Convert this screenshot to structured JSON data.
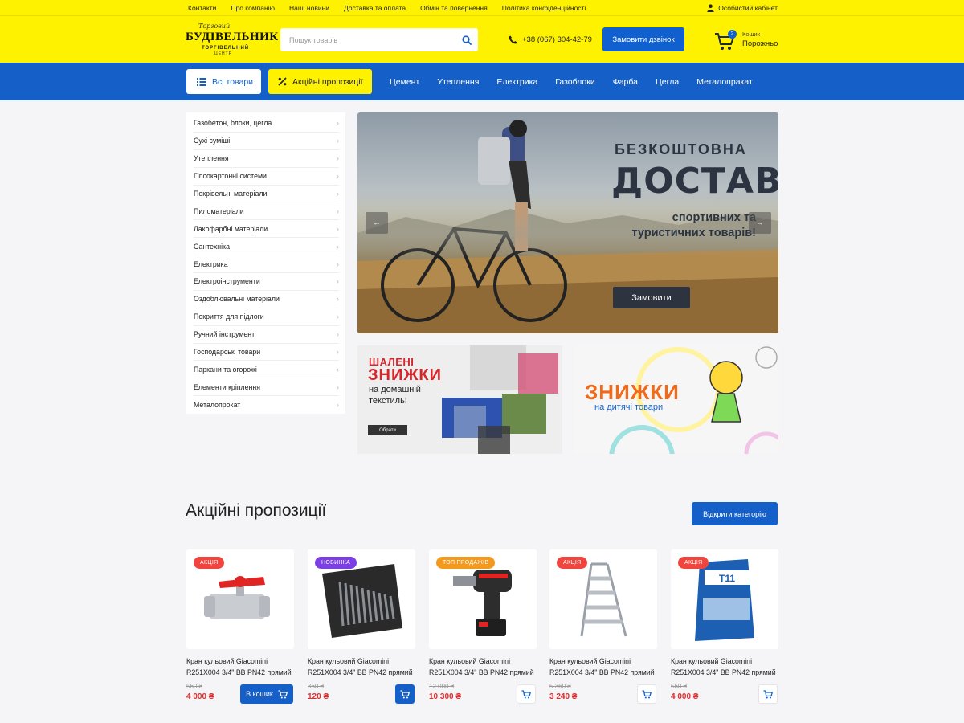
{
  "topbar": {
    "links": [
      "Контакти",
      "Про компанію",
      "Наші новини",
      "Доставка та оплата",
      "Обмін та повернення",
      "Політика конфіденційності"
    ],
    "cabinet": "Особистий кабінет"
  },
  "header": {
    "logo": {
      "script": "Торговий",
      "main": "БУДІВЕЛЬНИК",
      "sub": "ТОРГІВЕЛЬНИЙ",
      "sub2": "ЦЕНТР"
    },
    "search_placeholder": "Пошук товарів",
    "phone": "+38 (067) 304-42-79",
    "call_button": "Замовити дзвінок",
    "cart": {
      "count": "2",
      "label": "Кошик",
      "value": "Порожньо"
    }
  },
  "nav": {
    "all_products": "Всі товари",
    "promo": "Акційні пропозиції",
    "links": [
      "Цемент",
      "Утеплення",
      "Електрика",
      "Газоблоки",
      "Фарба",
      "Цегла",
      "Металопракат"
    ]
  },
  "sidebar": {
    "categories": [
      "Газобетон,  блоки, цегла",
      "Сухі суміші",
      "Утеплення",
      "Гіпсокартонні системи",
      "Покрівельні матеріали",
      "Пиломатеріали",
      "Лакофарбні матеріали",
      "Сантехніка",
      "Електрика",
      "Електроінструменти",
      "Оздоблювальні матеріали",
      "Покриття для підлоги",
      "Ручний інструмент",
      "Господарські товари",
      "Паркани та огорожі",
      "Елементи кріплення",
      "Металопрокат"
    ]
  },
  "hero": {
    "line1": "БЕЗКОШТОВНА",
    "line2": "ДОСТАВКА",
    "line3": "спортивних та туристичних товарів!",
    "button": "Замовити",
    "prev": "←",
    "next": "→"
  },
  "banners": {
    "textile": {
      "line1": "ШАЛЕНІ",
      "line2": "ЗНИЖКИ",
      "line3": "на домашній текстиль!",
      "button": "Обрати"
    },
    "kids": {
      "line1": "ЗНИЖКИ",
      "line2": "на дитячі товари"
    }
  },
  "promo_section": {
    "title": "Акційні пропозиції",
    "open_category": "Відкрити категорію",
    "products": [
      {
        "tag": "АКЦІЯ",
        "tag_color": "#f0453f",
        "name": "Кран кульовий Giacomini R251X004 3/4\" ВВ PN42 прямий",
        "old_price": "560 ₴",
        "price": "4 000 ₴",
        "buy_label": "В кошик",
        "buy_style": "full",
        "image": "valve"
      },
      {
        "tag": "НОВИНКА",
        "tag_color": "#7b3fe4",
        "name": "Кран кульовий Giacomini R251X004 3/4\" ВВ PN42 прямий",
        "old_price": "360 ₴",
        "price": "120 ₴",
        "buy_label": "",
        "buy_style": "solid",
        "image": "drills"
      },
      {
        "tag": "ТОП ПРОДАЖІВ",
        "tag_color": "#f39a1e",
        "name": "Кран кульовий Giacomini R251X004 3/4\" ВВ PN42 прямий",
        "old_price": "12 000 ₴",
        "price": "10 300 ₴",
        "buy_label": "",
        "buy_style": "ghost",
        "image": "drill"
      },
      {
        "tag": "АКЦІЯ",
        "tag_color": "#f0453f",
        "name": "Кран кульовий Giacomini R251X004 3/4\" ВВ PN42 прямий",
        "old_price": "5 360 ₴",
        "price": "3 240 ₴",
        "buy_label": "",
        "buy_style": "ghost",
        "image": "ladder"
      },
      {
        "tag": "АКЦІЯ",
        "tag_color": "#f0453f",
        "name": "Кран кульовий Giacomini R251X004 3/4\" ВВ PN42 прямий",
        "old_price": "560 ₴",
        "price": "4 000 ₴",
        "buy_label": "",
        "buy_style": "ghost",
        "image": "glue"
      }
    ]
  },
  "colors": {
    "yellow": "#fff200",
    "blue": "#1460c8",
    "red_price": "#e52b2b"
  }
}
